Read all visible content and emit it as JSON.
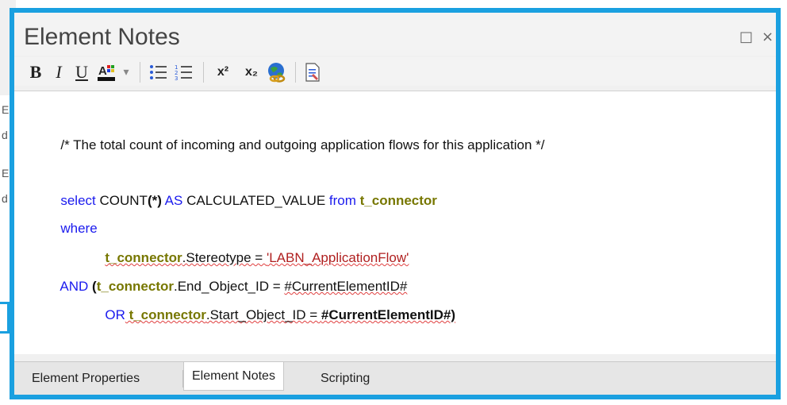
{
  "window": {
    "title": "Element Notes",
    "restore_glyph": "□",
    "close_glyph": "×"
  },
  "background": {
    "fragments": [
      "Ele",
      "d",
      "Ele",
      "d"
    ]
  },
  "toolbar": {
    "bold": "B",
    "italic": "I",
    "underline": "U",
    "color_dropdown": "▾",
    "superscript": "x²",
    "subscript": "x₂"
  },
  "editor": {
    "line1": "/* The total count of incoming and outgoing application flows for this application */",
    "line2_a": "select",
    "line2_b": " COUNT",
    "line2_c": "(*)",
    "line2_d": " AS",
    "line2_e": " CALCULATED_VALUE ",
    "line2_f": "from",
    "line2_g": " t_connector",
    "line3": "where",
    "line4_a": "t_connector",
    "line4_b": ".Stereotype = ",
    "line4_c": "'LABN_ApplicationFlow'",
    "line5_a": "AND",
    "line5_b": " (",
    "line5_c": "t_connector",
    "line5_d": ".End_Object_ID = ",
    "line5_e": "#CurrentElementID#",
    "line6_a": "OR",
    "line6_b": " t_connector",
    "line6_c": ".Start_Object_ID = ",
    "line6_d": "#CurrentElementID#)"
  },
  "tabs": [
    {
      "label": "Element Properties"
    },
    {
      "label": "Element Notes"
    },
    {
      "label": "Scripting"
    }
  ]
}
